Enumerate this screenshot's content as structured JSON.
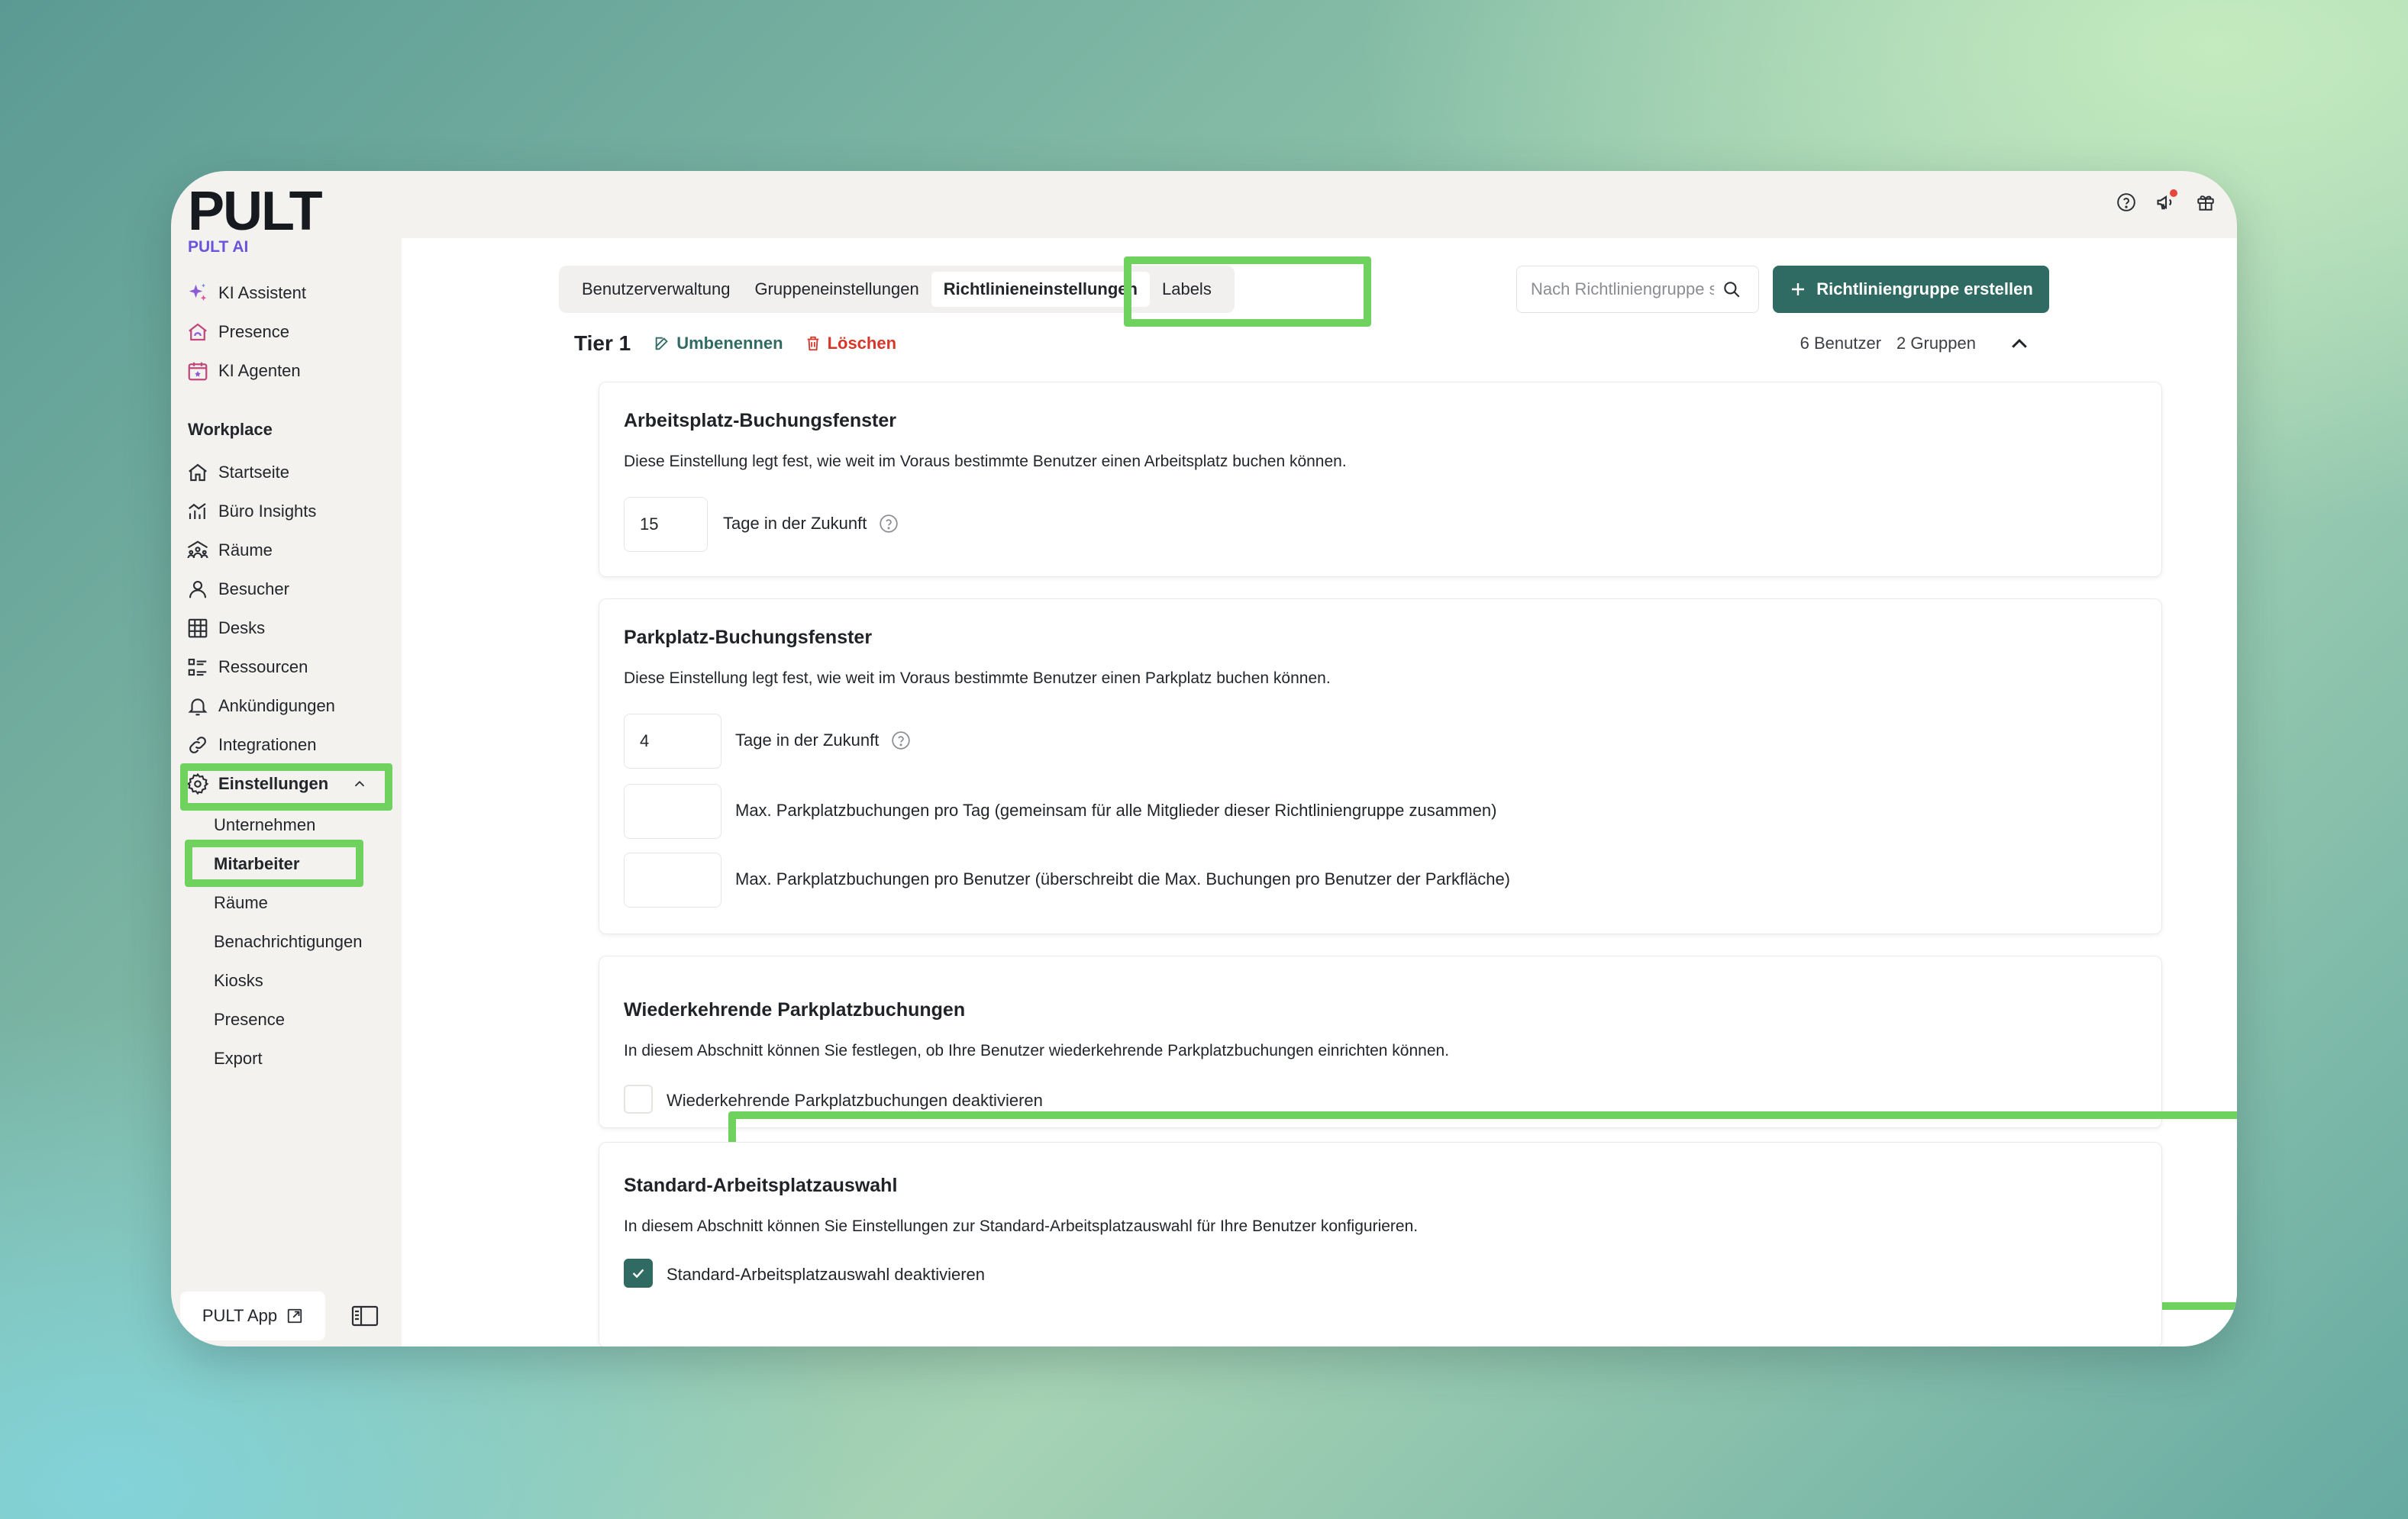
{
  "app": {
    "logo": "PULT",
    "section_ai": "PULT AI"
  },
  "top_icons": [
    "help-icon",
    "megaphone-icon",
    "gift-icon"
  ],
  "sidebar": {
    "ai_items": [
      {
        "label": "KI Assistent",
        "icon": "sparkles-icon"
      },
      {
        "label": "Presence",
        "icon": "presence-icon"
      },
      {
        "label": "KI Agenten",
        "icon": "agent-icon"
      }
    ],
    "workplace_label": "Workplace",
    "items": [
      {
        "label": "Startseite",
        "icon": "home-icon"
      },
      {
        "label": "Büro Insights",
        "icon": "chart-icon"
      },
      {
        "label": "Räume",
        "icon": "rooms-icon"
      },
      {
        "label": "Besucher",
        "icon": "user-icon"
      },
      {
        "label": "Desks",
        "icon": "desk-icon"
      },
      {
        "label": "Ressourcen",
        "icon": "list-icon"
      },
      {
        "label": "Ankündigungen",
        "icon": "bell-icon"
      },
      {
        "label": "Integrationen",
        "icon": "link-icon"
      },
      {
        "label": "Einstellungen",
        "icon": "gear-icon"
      }
    ],
    "settings_sub": [
      "Unternehmen",
      "Mitarbeiter",
      "Räume",
      "Benachrichtigungen",
      "Kiosks",
      "Presence",
      "Export"
    ],
    "active_sub": "Mitarbeiter",
    "app_button": "PULT App"
  },
  "tabs": [
    "Benutzerverwaltung",
    "Gruppeneinstellungen",
    "Richtlinieneinstellungen",
    "Labels"
  ],
  "active_tab": "Richtlinieneinstellungen",
  "search": {
    "placeholder": "Nach Richtliniengruppe suchen"
  },
  "create_button": "Richtliniengruppe erstellen",
  "tier": {
    "title": "Tier 1",
    "rename": "Umbenennen",
    "delete": "Löschen",
    "users": "6 Benutzer",
    "groups": "2 Gruppen"
  },
  "cards": {
    "workplace_window": {
      "title": "Arbeitsplatz-Buchungsfenster",
      "description": "Diese Einstellung legt fest, wie weit im Voraus bestimmte Benutzer einen Arbeitsplatz buchen können.",
      "value": "15",
      "unit": "Tage in der Zukunft"
    },
    "parking_window": {
      "title": "Parkplatz-Buchungsfenster",
      "description": "Diese Einstellung legt fest, wie weit im Voraus bestimmte Benutzer einen Parkplatz buchen können.",
      "value": "4",
      "unit": "Tage in der Zukunft",
      "max_per_day_value": "",
      "max_per_day_label": "Max. Parkplatzbuchungen pro Tag (gemeinsam für alle Mitglieder dieser Richtliniengruppe zusammen)",
      "max_per_user_value": "",
      "max_per_user_label": "Max. Parkplatzbuchungen pro Benutzer (überschreibt die Max. Buchungen pro Benutzer der Parkfläche)"
    },
    "recurring_parking": {
      "title": "Wiederkehrende Parkplatzbuchungen",
      "description": "In diesem Abschnitt können Sie festlegen, ob Ihre Benutzer wiederkehrende Parkplatzbuchungen einrichten können.",
      "checkbox_label": "Wiederkehrende Parkplatzbuchungen deaktivieren",
      "checked": false
    },
    "default_workplace": {
      "title": "Standard-Arbeitsplatzauswahl",
      "description": "In diesem Abschnitt können Sie Einstellungen zur Standard-Arbeitsplatzauswahl für Ihre Benutzer konfigurieren.",
      "checkbox_label": "Standard-Arbeitsplatzauswahl deaktivieren",
      "checked": true
    }
  },
  "highlight_color": "#6fd25f",
  "accent_color": "#2f6b63"
}
